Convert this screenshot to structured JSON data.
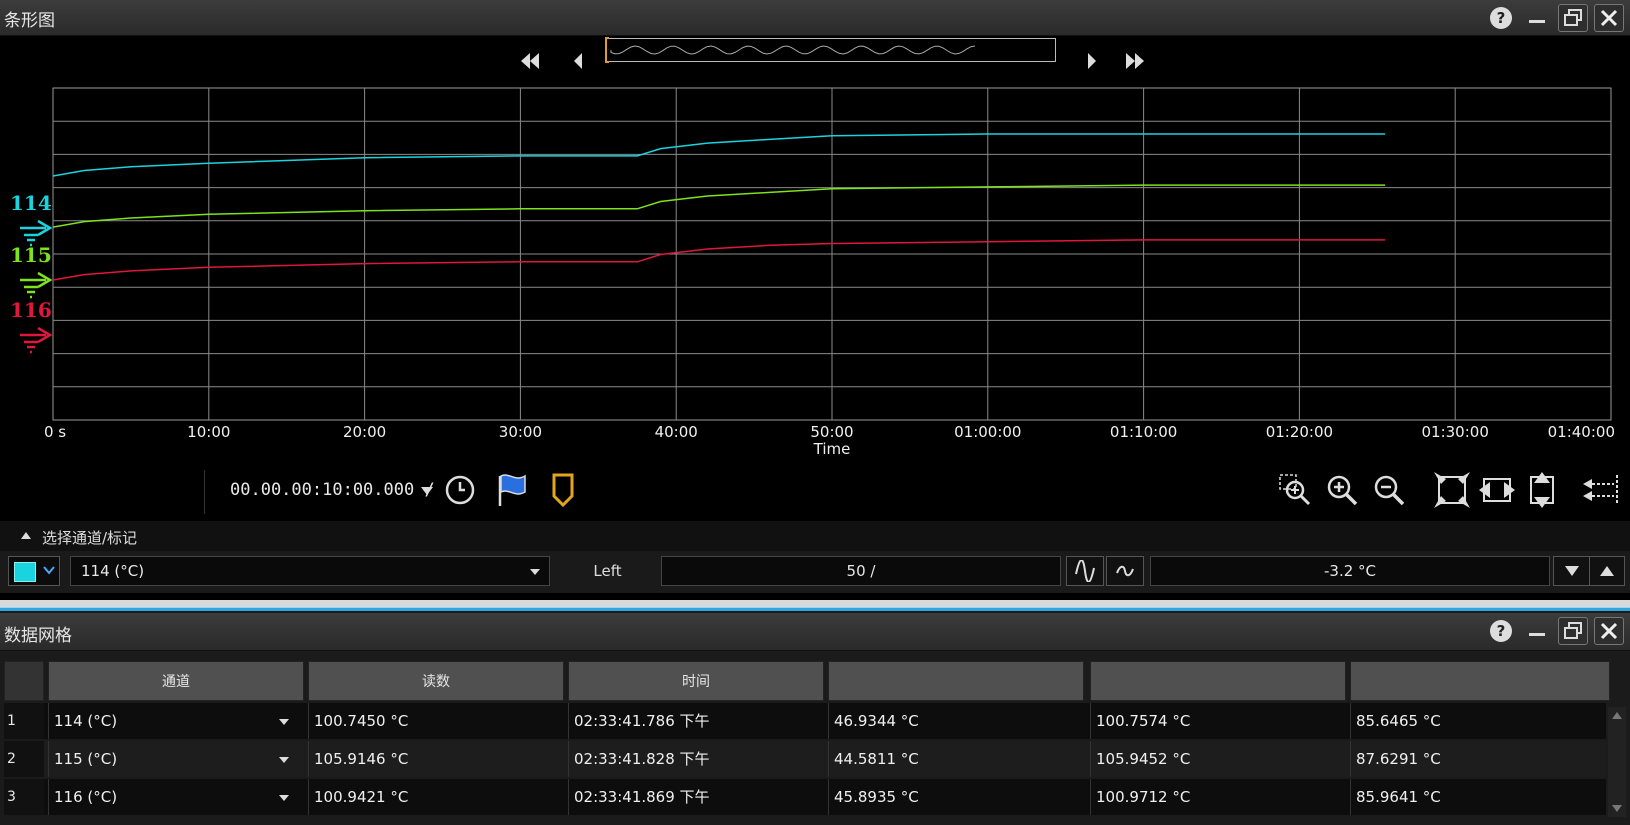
{
  "strip_panel": {
    "title": "条形图",
    "time_window": "00.00.00:10:00.000 /",
    "selector_label": "选择通道/标记",
    "channel_select": "114 (°C)",
    "side_label": "Left",
    "scale_field": "50  /",
    "offset_field": "-3.2 °C",
    "swatch_color": "#19d4df"
  },
  "chart_data": {
    "type": "line",
    "title": "",
    "xlabel": "Time",
    "ylabel": "",
    "x_ticks": [
      "0 s",
      "10:00",
      "20:00",
      "30:00",
      "40:00",
      "50:00",
      "01:00:00",
      "01:10:00",
      "01:20:00",
      "01:30:00",
      "01:40:00"
    ],
    "xlim_minutes": [
      0,
      100
    ],
    "grid": true,
    "series": [
      {
        "name": "114",
        "color": "#19d4df",
        "x_minutes": [
          0,
          2,
          5,
          10,
          20,
          30,
          37.5,
          39,
          42,
          46,
          50,
          60,
          70,
          80,
          85.5
        ],
        "level": [
          0.4,
          0.43,
          0.45,
          0.47,
          0.5,
          0.51,
          0.51,
          0.55,
          0.58,
          0.6,
          0.62,
          0.63,
          0.63,
          0.63,
          0.63
        ]
      },
      {
        "name": "115",
        "color": "#7fe21b",
        "x_minutes": [
          0,
          2,
          5,
          10,
          20,
          30,
          37.5,
          39,
          42,
          46,
          50,
          60,
          70,
          80,
          85.5
        ],
        "level": [
          0.12,
          0.15,
          0.17,
          0.19,
          0.21,
          0.22,
          0.22,
          0.26,
          0.29,
          0.31,
          0.33,
          0.34,
          0.35,
          0.35,
          0.35
        ]
      },
      {
        "name": "116",
        "color": "#e0173d",
        "x_minutes": [
          0,
          2,
          5,
          10,
          20,
          30,
          37.5,
          39,
          42,
          46,
          50,
          60,
          70,
          80,
          85.5
        ],
        "level": [
          -0.17,
          -0.14,
          -0.12,
          -0.1,
          -0.08,
          -0.07,
          -0.07,
          -0.03,
          0.0,
          0.02,
          0.03,
          0.04,
          0.05,
          0.05,
          0.05
        ]
      }
    ]
  },
  "grid_panel": {
    "title": "数据网格",
    "headers": [
      "通道",
      "读数",
      "时间",
      "",
      "",
      ""
    ],
    "rows": [
      {
        "num": "1",
        "channel": "114 (°C)",
        "reading": "100.7450 °C",
        "time": "02:33:41.786 下午",
        "c4": "46.9344 °C",
        "c5": "100.7574 °C",
        "c6": "85.6465 °C"
      },
      {
        "num": "2",
        "channel": "115 (°C)",
        "reading": "105.9146 °C",
        "time": "02:33:41.828 下午",
        "c4": "44.5811 °C",
        "c5": "105.9452 °C",
        "c6": "87.6291 °C"
      },
      {
        "num": "3",
        "channel": "116 (°C)",
        "reading": "100.9421 °C",
        "time": "02:33:41.869 下午",
        "c4": "45.8935 °C",
        "c5": "100.9712 °C",
        "c6": "85.9641 °C"
      }
    ]
  }
}
